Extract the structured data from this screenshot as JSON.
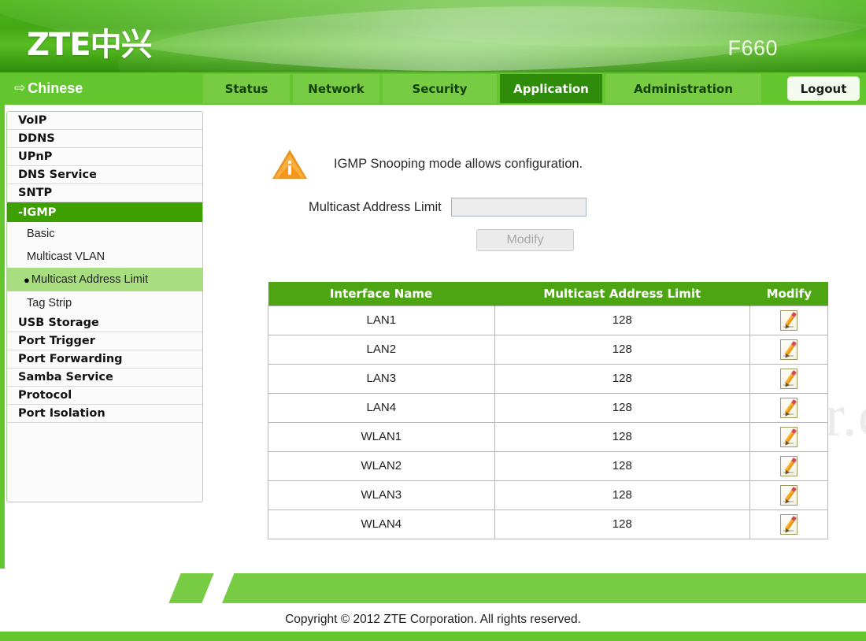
{
  "header": {
    "brand": "ZTE中兴",
    "model": "F660"
  },
  "nav": {
    "language_label": "Chinese",
    "language_arrow_icon": "arrow-right-icon",
    "tabs": [
      {
        "label": "Status",
        "active": false
      },
      {
        "label": "Network",
        "active": false
      },
      {
        "label": "Security",
        "active": false
      },
      {
        "label": "Application",
        "active": true
      },
      {
        "label": "Administration",
        "active": false
      }
    ],
    "logout_label": "Logout"
  },
  "sidebar": {
    "top_items": [
      {
        "label": "VoIP"
      },
      {
        "label": "DDNS"
      },
      {
        "label": "UPnP"
      },
      {
        "label": "DNS Service"
      },
      {
        "label": "SNTP"
      }
    ],
    "active_item": {
      "label": "-IGMP"
    },
    "sub_items": [
      {
        "label": "Basic",
        "selected": false
      },
      {
        "label": "Multicast VLAN",
        "selected": false
      },
      {
        "label": "Multicast Address Limit",
        "selected": true,
        "bullet": "●"
      },
      {
        "label": "Tag Strip",
        "selected": false
      }
    ],
    "bottom_items": [
      {
        "label": "USB Storage"
      },
      {
        "label": "Port Trigger"
      },
      {
        "label": "Port Forwarding"
      },
      {
        "label": "Samba Service"
      },
      {
        "label": "Protocol"
      },
      {
        "label": "Port Isolation"
      }
    ]
  },
  "main": {
    "notice": {
      "icon": "warning-info-icon",
      "text": "IGMP Snooping mode allows configuration."
    },
    "form": {
      "label": "Multicast Address Limit",
      "input_value": "",
      "input_placeholder": "",
      "modify_label": "Modify",
      "modify_disabled": true
    },
    "watermark": "SetupRouter.com",
    "table": {
      "columns": [
        "Interface Name",
        "Multicast Address Limit",
        "Modify"
      ],
      "modify_icon": "pencil-edit-icon",
      "rows": [
        {
          "interface": "LAN1",
          "limit": "128"
        },
        {
          "interface": "LAN2",
          "limit": "128"
        },
        {
          "interface": "LAN3",
          "limit": "128"
        },
        {
          "interface": "LAN4",
          "limit": "128"
        },
        {
          "interface": "WLAN1",
          "limit": "128"
        },
        {
          "interface": "WLAN2",
          "limit": "128"
        },
        {
          "interface": "WLAN3",
          "limit": "128"
        },
        {
          "interface": "WLAN4",
          "limit": "128"
        }
      ]
    }
  },
  "footer": {
    "copyright": "Copyright © 2012 ZTE Corporation. All rights reserved."
  },
  "colors": {
    "brand_green": "#64c62e",
    "tab_green": "#78cc44",
    "active_tab_green": "#2f8c0a",
    "active_nav_green": "#3da000",
    "selected_sub_green": "#a8de7f",
    "table_header_green": "#4da513",
    "info_orange": "#f7941e"
  }
}
